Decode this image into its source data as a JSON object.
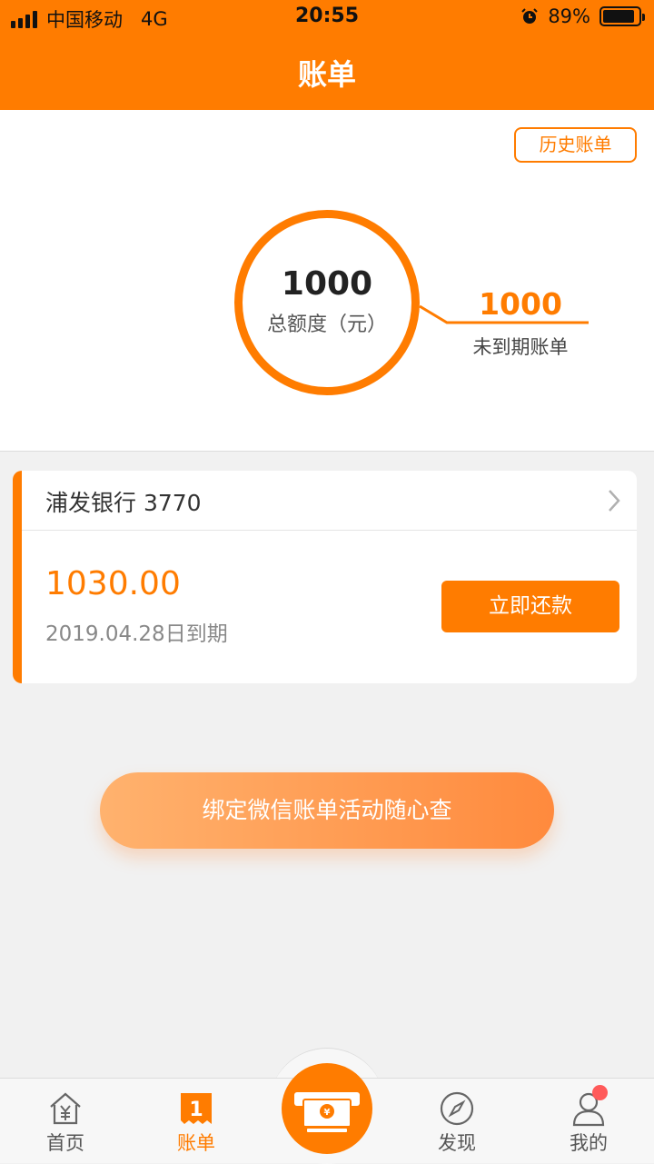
{
  "status_bar": {
    "carrier": "中国移动",
    "network": "4G",
    "time": "20:55",
    "battery_text": "89%",
    "battery_level": 0.89,
    "alarm_icon": "alarm-icon"
  },
  "nav": {
    "title": "账单"
  },
  "summary": {
    "history_label": "历史账单",
    "total_value": "1000",
    "total_label": "总额度（元）",
    "unpaid_value": "1000",
    "unpaid_label": "未到期账单"
  },
  "bill": {
    "bank_name": "浦发银行 3770",
    "amount": "1030.00",
    "due_date": "2019.04.28日到期",
    "repay_label": "立即还款"
  },
  "promo": {
    "label": "绑定微信账单活动随心查"
  },
  "tabs": [
    {
      "label": "首页",
      "icon": "home-yuan-icon",
      "active": false
    },
    {
      "label": "账单",
      "icon": "bill-icon",
      "active": true
    },
    {
      "label": "",
      "icon": "cash-machine-icon",
      "active": false
    },
    {
      "label": "发现",
      "icon": "compass-icon",
      "active": false
    },
    {
      "label": "我的",
      "icon": "user-icon",
      "active": false,
      "badge": true
    }
  ],
  "colors": {
    "accent": "#ff7c00",
    "badge": "#ff5a5a"
  }
}
